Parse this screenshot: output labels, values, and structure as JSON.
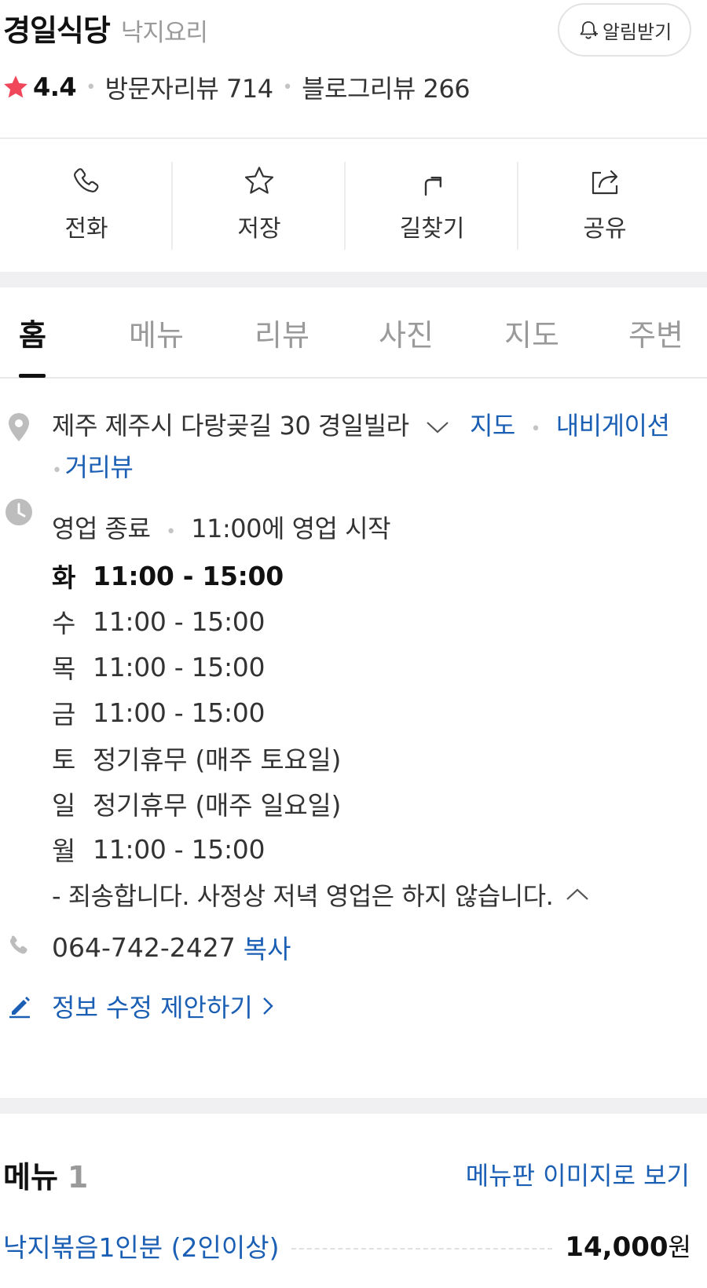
{
  "header": {
    "name": "경일식당",
    "category": "낙지요리",
    "alarm_label": "알림받기",
    "rating": "4.4",
    "visitor_reviews": "방문자리뷰 714",
    "blog_reviews": "블로그리뷰 266"
  },
  "actions": [
    {
      "label": "전화",
      "icon": "phone-icon"
    },
    {
      "label": "저장",
      "icon": "star-icon"
    },
    {
      "label": "길찾기",
      "icon": "directions-icon"
    },
    {
      "label": "공유",
      "icon": "share-icon"
    }
  ],
  "tabs": [
    "홈",
    "메뉴",
    "리뷰",
    "사진",
    "지도",
    "주변"
  ],
  "active_tab": "홈",
  "address": {
    "text": "제주 제주시 다랑곶길 30 경일빌라",
    "map_link": "지도",
    "navigation_link": "내비게이션",
    "street_view_link": "거리뷰"
  },
  "hours": {
    "status": "영업 종료",
    "next_open": "11:00에 영업 시작",
    "schedule": [
      {
        "day": "화",
        "time": "11:00 - 15:00"
      },
      {
        "day": "수",
        "time": "11:00 - 15:00"
      },
      {
        "day": "목",
        "time": "11:00 - 15:00"
      },
      {
        "day": "금",
        "time": "11:00 - 15:00"
      },
      {
        "day": "토",
        "time": "정기휴무 (매주 토요일)"
      },
      {
        "day": "일",
        "time": "정기휴무 (매주 일요일)"
      },
      {
        "day": "월",
        "time": "11:00 - 15:00"
      }
    ],
    "note": "- 죄송합니다. 사정상 저녁 영업은 하지 않습니다."
  },
  "phone": {
    "number": "064-742-2427",
    "copy_label": "복사"
  },
  "suggest_edit": "정보 수정 제안하기",
  "menu": {
    "title": "메뉴",
    "count": "1",
    "view_image_link": "메뉴판 이미지로 보기",
    "items": [
      {
        "name": "낙지볶음1인분 (2인이상)",
        "price": "14,000",
        "unit": "원"
      }
    ]
  },
  "colors": {
    "accent_blue": "#1a5fb4",
    "star_red": "#f0475a",
    "muted_gray": "#9a9a9a"
  }
}
